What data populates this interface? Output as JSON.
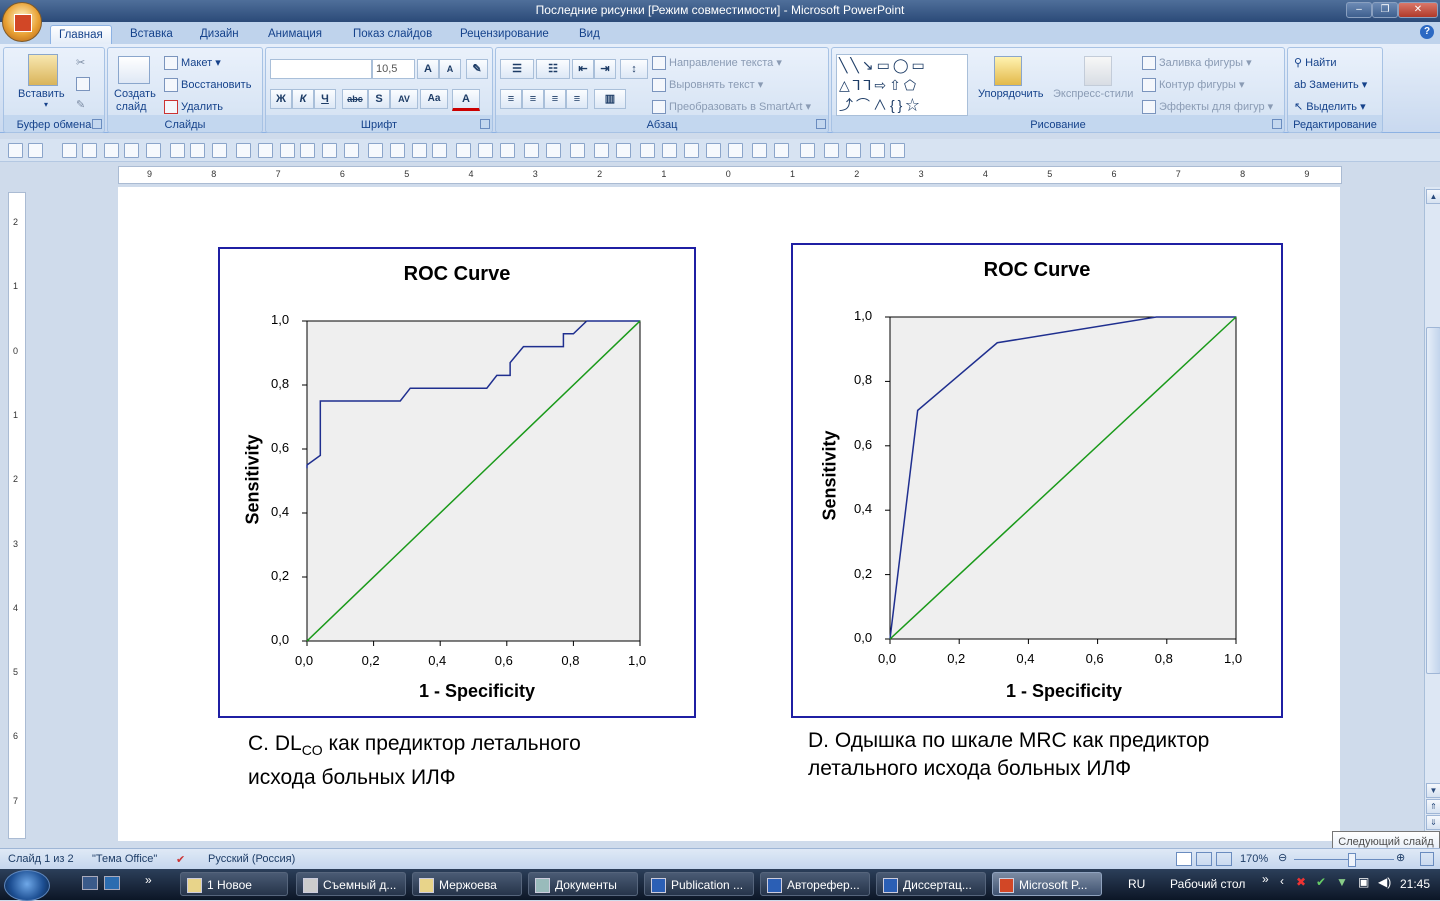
{
  "window": {
    "title": "Последние рисунки [Режим совместимости] - Microsoft PowerPoint"
  },
  "tabs": [
    "Главная",
    "Вставка",
    "Дизайн",
    "Анимация",
    "Показ слайдов",
    "Рецензирование",
    "Вид"
  ],
  "ribbon": {
    "clipboard": {
      "label": "Буфер обмена",
      "paste": "Вставить"
    },
    "slides": {
      "label": "Слайды",
      "new_slide_1": "Создать",
      "new_slide_2": "слайд",
      "layout": "Макет",
      "reset": "Восстановить",
      "delete": "Удалить"
    },
    "font": {
      "label": "Шрифт",
      "font_name": "",
      "font_size": "10,5"
    },
    "paragraph": {
      "label": "Абзац",
      "text_direction": "Направление текста",
      "align_text": "Выровнять текст",
      "smartart": "Преобразовать в SmartArt"
    },
    "drawing": {
      "label": "Рисование",
      "arrange": "Упорядочить",
      "quick_styles": "Экспресс-стили",
      "shape_fill": "Заливка фигуры",
      "shape_outline": "Контур фигуры",
      "shape_effects": "Эффекты для фигур"
    },
    "editing": {
      "label": "Редактирование",
      "find": "Найти",
      "replace": "Заменить",
      "select": "Выделить"
    }
  },
  "ruler": {
    "h_labels": [
      "9",
      "8",
      "7",
      "6",
      "5",
      "4",
      "3",
      "2",
      "1",
      "0",
      "1",
      "2",
      "3",
      "4",
      "5",
      "6",
      "7",
      "8",
      "9"
    ],
    "v_labels": [
      "2",
      "1",
      "0",
      "1",
      "2",
      "3",
      "4",
      "5",
      "6",
      "7"
    ]
  },
  "chart_data": [
    {
      "type": "line",
      "title": "ROC Curve",
      "xlabel": "1 - Specificity",
      "ylabel": "Sensitivity",
      "xlim": [
        0,
        1
      ],
      "ylim": [
        0,
        1
      ],
      "ticks": [
        "0,0",
        "0,2",
        "0,4",
        "0,6",
        "0,8",
        "1,0"
      ],
      "series": [
        {
          "color": "#1f2f8f",
          "x": [
            0,
            0,
            0.04,
            0.04,
            0.28,
            0.31,
            0.54,
            0.57,
            0.61,
            0.61,
            0.65,
            0.77,
            0.77,
            0.8,
            0.84,
            1.0
          ],
          "y": [
            0.54,
            0.55,
            0.58,
            0.75,
            0.75,
            0.79,
            0.79,
            0.83,
            0.83,
            0.87,
            0.92,
            0.92,
            0.96,
            0.96,
            1.0,
            1.0
          ]
        },
        {
          "color": "#1a9a1a",
          "x": [
            0,
            1
          ],
          "y": [
            0,
            1
          ]
        }
      ],
      "caption_pre": "C. DL",
      "caption_sub": "CO",
      "caption_post": " как предиктор летального",
      "caption_line2": "исхода больных ИЛФ"
    },
    {
      "type": "line",
      "title": "ROC Curve",
      "xlabel": "1 - Specificity",
      "ylabel": "Sensitivity",
      "xlim": [
        0,
        1
      ],
      "ylim": [
        0,
        1
      ],
      "ticks": [
        "0,0",
        "0,2",
        "0,4",
        "0,6",
        "0,8",
        "1,0"
      ],
      "series": [
        {
          "color": "#1f2f8f",
          "x": [
            0,
            0.08,
            0.31,
            0.77,
            1.0
          ],
          "y": [
            0,
            0.71,
            0.92,
            1.0,
            1.0
          ]
        },
        {
          "color": "#1a9a1a",
          "x": [
            0,
            1
          ],
          "y": [
            0,
            1
          ]
        }
      ],
      "caption_line1": "D. Одышка по шкале MRC как предиктор",
      "caption_line2": "летального исхода больных ИЛФ"
    }
  ],
  "status": {
    "slide": "Слайд 1 из 2",
    "theme": "\"Тема Office\"",
    "language": "Русский (Россия)",
    "zoom": "170%"
  },
  "tooltip": "Следующий слайд",
  "taskbar": {
    "items": [
      "1 Новое",
      "Съемный д...",
      "Мержоева",
      "Документы",
      "Publication ...",
      "Авторефер...",
      "Диссертац...",
      "Microsoft P..."
    ],
    "lang": "RU",
    "desktop": "Рабочий стол",
    "clock": "21:45"
  },
  "colors": {
    "chart_frame": "#1f1fa3",
    "roc_line": "#1f2f8f",
    "reference_line": "#1a9a1a",
    "plot_bg": "#efefef"
  }
}
